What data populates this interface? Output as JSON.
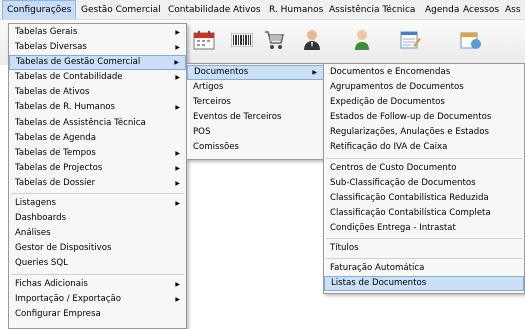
{
  "menubar": {
    "items": [
      "Configurações",
      "Gestão Comercial",
      "Contabilidade",
      "Ativos",
      "R. Humanos",
      "Assistência Técnica",
      "Agenda",
      "Acessos",
      "Ass"
    ]
  },
  "toolbar": {
    "icons": [
      "calendar-icon",
      "barcode-icon",
      "shopping-cart-icon",
      "person-icon",
      "user-icon",
      "notepad-icon",
      "calendar-blue-icon"
    ]
  },
  "menu_config": {
    "items": [
      {
        "label": "Tabelas Gerais",
        "arrow": "▶"
      },
      {
        "label": "Tabelas Diversas",
        "arrow": "▶"
      },
      {
        "label": "Tabelas de Gestão Comercial",
        "arrow": "▶"
      },
      {
        "label": "Tabelas de Contabilidade",
        "arrow": "▶"
      },
      {
        "label": "Tabelas de Ativos",
        "arrow": ""
      },
      {
        "label": "Tabelas de R. Humanos",
        "arrow": "▶"
      },
      {
        "label": "Tabelas de Assistência Técnica",
        "arrow": ""
      },
      {
        "label": "Tabelas de Agenda",
        "arrow": ""
      },
      {
        "label": "Tabelas de Tempos",
        "arrow": "▶"
      },
      {
        "label": "Tabelas de Projectos",
        "arrow": "▶"
      },
      {
        "label": "Tabelas de Dossier",
        "arrow": "▶"
      },
      {
        "label": "Listagens",
        "arrow": "▶"
      },
      {
        "label": "Dashboards",
        "arrow": ""
      },
      {
        "label": "Análises",
        "arrow": ""
      },
      {
        "label": "Gestor de Dispositivos",
        "arrow": ""
      },
      {
        "label": "Queries SQL",
        "arrow": ""
      },
      {
        "label": "Fichas Adicionais",
        "arrow": "▶"
      },
      {
        "label": "Importação / Exportação",
        "arrow": "▶"
      },
      {
        "label": "Configurar Empresa",
        "arrow": ""
      }
    ]
  },
  "menu_gestao": {
    "items": [
      {
        "label": "Documentos",
        "arrow": "▶"
      },
      {
        "label": "Artigos",
        "arrow": ""
      },
      {
        "label": "Terceiros",
        "arrow": ""
      },
      {
        "label": "Eventos de Terceiros",
        "arrow": ""
      },
      {
        "label": "POS",
        "arrow": ""
      },
      {
        "label": "Comissões",
        "arrow": ""
      }
    ]
  },
  "menu_documentos": {
    "items": [
      {
        "label": "Documentos e Encomendas"
      },
      {
        "label": "Agrupamentos de Documentos"
      },
      {
        "label": "Expedição de Documentos"
      },
      {
        "label": "Estados de Follow-up de Documentos"
      },
      {
        "label": "Regularizações, Anulações e Estados"
      },
      {
        "label": "Retificação do IVA de Caixa"
      },
      {
        "label": "Centros de Custo Documento"
      },
      {
        "label": "Sub-Classificação de Documentos"
      },
      {
        "label": "Classificação Contabilística Reduzida"
      },
      {
        "label": "Classificação Contabilística Completa"
      },
      {
        "label": "Condições Entrega - Intrastat"
      },
      {
        "label": "Títulos"
      },
      {
        "label": "Faturação Automática"
      },
      {
        "label": "Listas de Documentos"
      }
    ]
  },
  "colors": {
    "highlight": "#c9e0f7",
    "highlight_border": "#86abd6",
    "menu_bg": "#f7f7f7"
  }
}
